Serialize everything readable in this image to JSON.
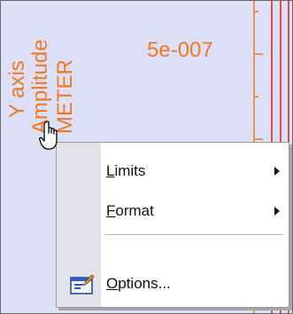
{
  "axis": {
    "label_line1": "Y axis",
    "label_line2": "Amplitude",
    "label_line3": "METER",
    "tick_value": "5e-007"
  },
  "colors": {
    "axis_text": "#f07a22",
    "plot_line": "#e11b1b",
    "panel_bg": "#dcdff5",
    "menu_gutter": "#e3e3ec"
  },
  "context_menu": {
    "items": [
      {
        "label": "Limits",
        "submenu": true,
        "mnemonic": "L"
      },
      {
        "label": "Format",
        "submenu": true,
        "mnemonic": "F"
      },
      {
        "label": "Options...",
        "submenu": false,
        "mnemonic": "O",
        "icon": "options-icon"
      }
    ]
  },
  "cursor": {
    "icon": "hand-pointer-icon"
  }
}
